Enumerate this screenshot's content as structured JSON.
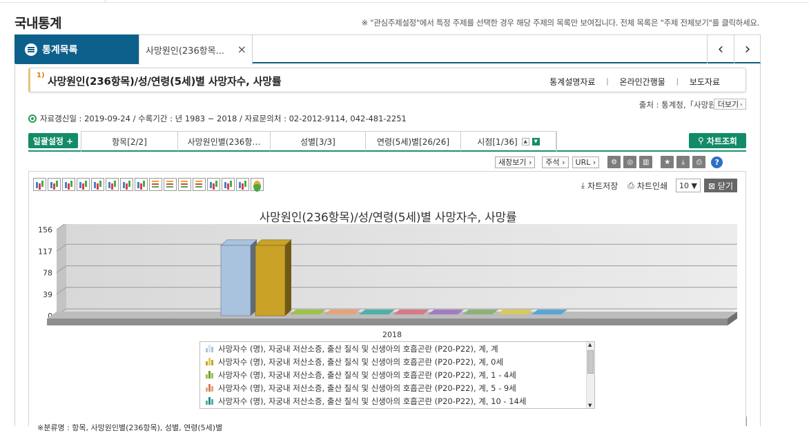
{
  "page": {
    "title": "국내통계",
    "notice": "※ \"관심주제설정\"에서 특정 주제를 선택한 경우 해당 주제의 목록만 보여집니다. 전체 목록은 \"주제 전체보기\"를 클릭하세요."
  },
  "tabs": {
    "list_label": "통계목록",
    "active_label": "사망원인(236항목...",
    "close_glyph": "×",
    "prev_glyph": "‹",
    "next_glyph": "›"
  },
  "table": {
    "number": "1)",
    "title": "사망원인(236항목)/성/연령(5세)별 사망자수, 사망률",
    "links": [
      "통계설명자료",
      "온라인간행물",
      "보도자료"
    ],
    "link_sep": "ㅣ",
    "source": "출처 : 통계청,「사망원인통계」",
    "more_label": "더보기",
    "info": "자료갱신일 : 2019-09-24 / 수록기간 : 년 1983 ~ 2018 / 자료문의처 : 02-2012-9114, 042-481-2251"
  },
  "filters": {
    "bulk_label": "일괄설정 +",
    "tabs": [
      "항목[2/2]",
      "사망원인별(236항…",
      "성별[3/3]",
      "연령(5세)별[26/26]",
      "시점[1/36]"
    ],
    "search_label": "차트조회",
    "up_glyph": "▲",
    "down_glyph": "▼"
  },
  "toolbar": {
    "new_window": "새창보기 ›",
    "note": "주석 ›",
    "url": "URL ›",
    "help": "?"
  },
  "chart_tools": {
    "save_label": "차트저장",
    "print_label": "차트인쇄",
    "count_value": "10 ▼",
    "close_label": "⊠ 닫기"
  },
  "chart_data": {
    "type": "bar",
    "title": "사망원인(236항목)/성/연령(5세)별 사망자수, 사망률",
    "categories": [
      "2018"
    ],
    "ylim": [
      0,
      156
    ],
    "yticks": [
      0,
      39,
      78,
      117,
      156
    ],
    "series": [
      {
        "name": "사망자수 (명), 자궁내 저산소증, 출산 질식 및 신생아의 호흡곤란 (P20-P22), 계, 계",
        "values": [
          130
        ],
        "color": "#a9c3df"
      },
      {
        "name": "사망자수 (명), 자궁내 저산소증, 출산 질식 및 신생아의 호흡곤란 (P20-P22), 계, 0세",
        "values": [
          130
        ],
        "color": "#c9a227"
      },
      {
        "name": "사망자수 (명), 자궁내 저산소증, 출산 질식 및 신생아의 호흡곤란 (P20-P22), 계, 1 - 4세",
        "values": [
          0
        ],
        "color": "#9cc24a"
      },
      {
        "name": "사망자수 (명), 자궁내 저산소증, 출산 질식 및 신생아의 호흡곤란 (P20-P22), 계, 5 - 9세",
        "values": [
          0
        ],
        "color": "#e8a27a"
      },
      {
        "name": "사망자수 (명), 자궁내 저산소증, 출산 질식 및 신생아의 호흡곤란 (P20-P22), 계, 10 - 14세",
        "values": [
          0
        ],
        "color": "#4fb0a8"
      },
      {
        "name": "",
        "values": [
          0
        ],
        "color": "#d87a86"
      },
      {
        "name": "",
        "values": [
          0
        ],
        "color": "#a27bc1"
      },
      {
        "name": "",
        "values": [
          0
        ],
        "color": "#8cb27a"
      },
      {
        "name": "",
        "values": [
          0
        ],
        "color": "#d7c95e"
      },
      {
        "name": "",
        "values": [
          0
        ],
        "color": "#5aa6d8"
      }
    ],
    "legend_colors": [
      [
        "#a9c3df",
        "#cfe0f0",
        "#a9c3df"
      ],
      [
        "#c9a227",
        "#e3c95a",
        "#c9a227"
      ],
      [
        "#9cc24a",
        "#6f9a2c",
        "#9cc24a"
      ],
      [
        "#e8a27a",
        "#d87a4a",
        "#e8a27a"
      ],
      [
        "#4fb0a8",
        "#2a8a86",
        "#4fb0a8"
      ]
    ],
    "grid": true
  },
  "bottom_text": "※분류명 : 항목, 사망원인별(236항목), 성별, 연령(5세)별"
}
